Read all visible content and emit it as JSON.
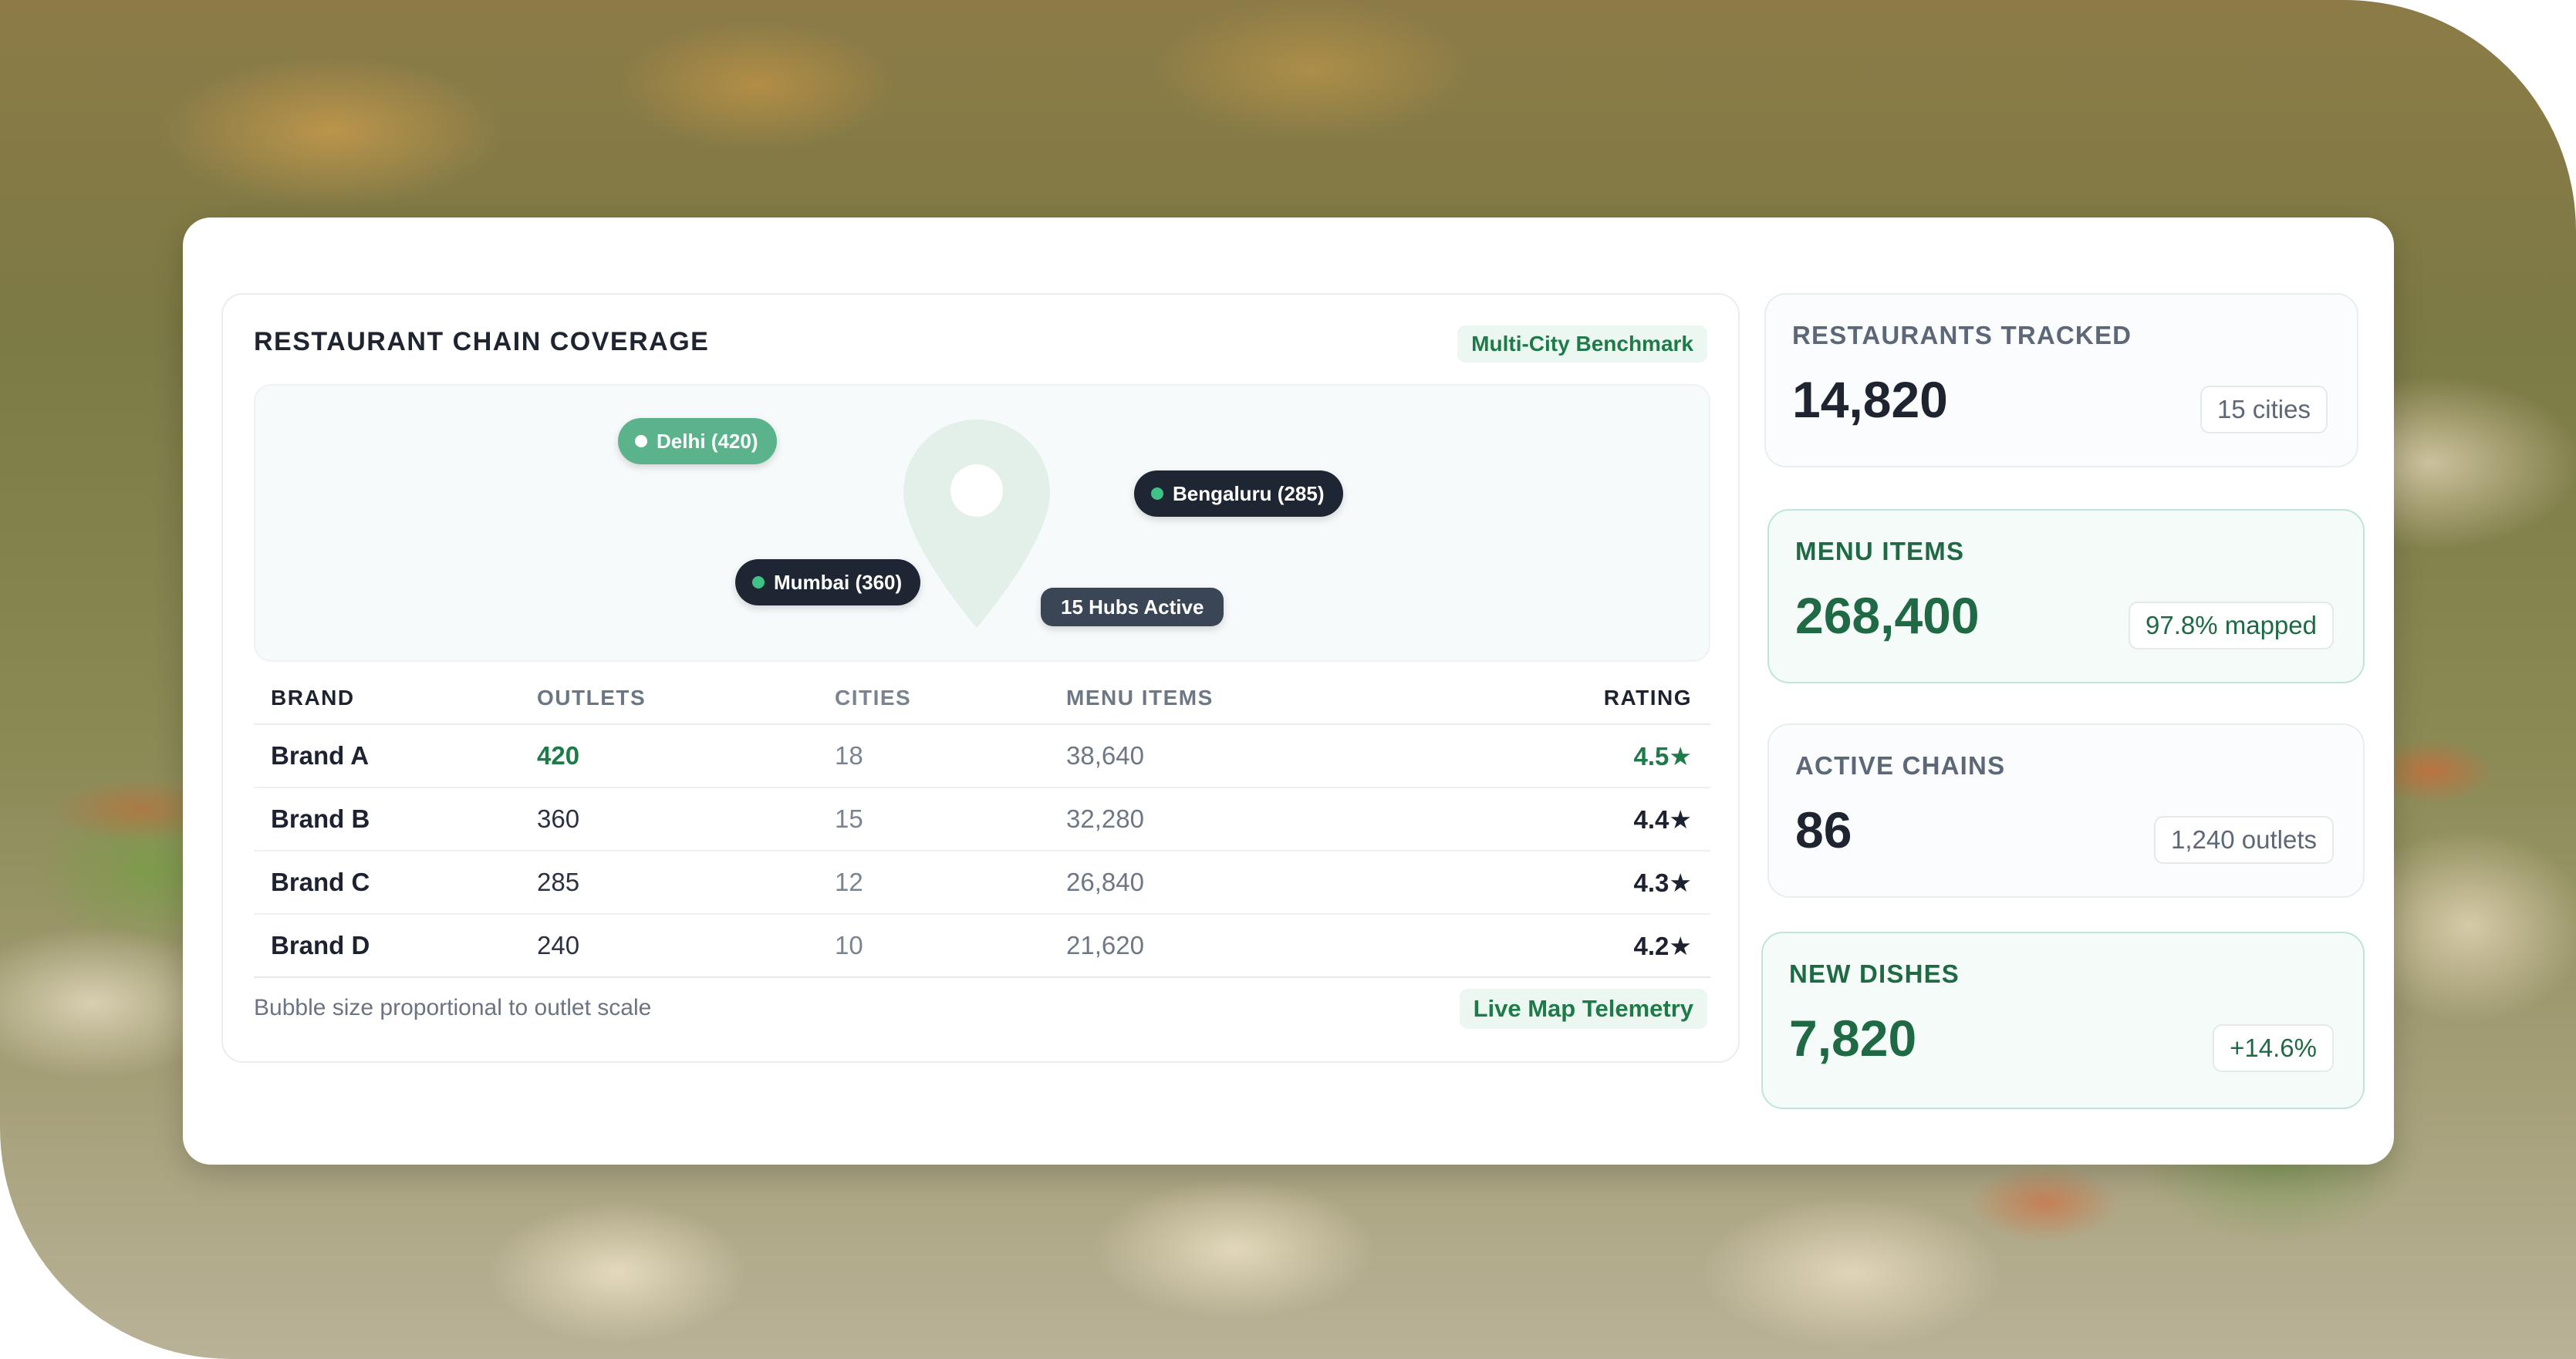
{
  "coverage": {
    "title": "RESTAURANT CHAIN COVERAGE",
    "benchmark_tag": "Multi-City Benchmark",
    "map": {
      "chips": [
        {
          "label": "Delhi (420)",
          "style": "green"
        },
        {
          "label": "Bengaluru (285)",
          "style": "dark"
        },
        {
          "label": "Mumbai (360)",
          "style": "dark"
        }
      ],
      "hubs_label": "15 Hubs Active",
      "pin_icon": "map-pin-icon"
    },
    "table": {
      "headers": [
        "BRAND",
        "OUTLETS",
        "CITIES",
        "MENU ITEMS",
        "RATING"
      ],
      "rows": [
        {
          "brand": "Brand A",
          "outlets": "420",
          "cities": "18",
          "menu_items": "38,640",
          "rating": "4.5★"
        },
        {
          "brand": "Brand B",
          "outlets": "360",
          "cities": "15",
          "menu_items": "32,280",
          "rating": "4.4★"
        },
        {
          "brand": "Brand C",
          "outlets": "285",
          "cities": "12",
          "menu_items": "26,840",
          "rating": "4.3★"
        },
        {
          "brand": "Brand D",
          "outlets": "240",
          "cities": "10",
          "menu_items": "21,620",
          "rating": "4.2★"
        }
      ]
    },
    "footnote": "Bubble size proportional to outlet scale",
    "telemetry_tag": "Live Map Telemetry"
  },
  "stats": [
    {
      "label": "RESTAURANTS TRACKED",
      "value": "14,820",
      "badge": "15 cities"
    },
    {
      "label": "MENU ITEMS",
      "value": "268,400",
      "badge": "97.8% mapped"
    },
    {
      "label": "ACTIVE CHAINS",
      "value": "86",
      "badge": "1,240 outlets"
    },
    {
      "label": "NEW DISHES",
      "value": "7,820",
      "badge": "+14.6%"
    }
  ],
  "colors": {
    "accent_green": "#1f7a4a",
    "chip_green": "#5ab38a",
    "chip_dark": "#1f2633",
    "pin": "#e3efe9"
  }
}
